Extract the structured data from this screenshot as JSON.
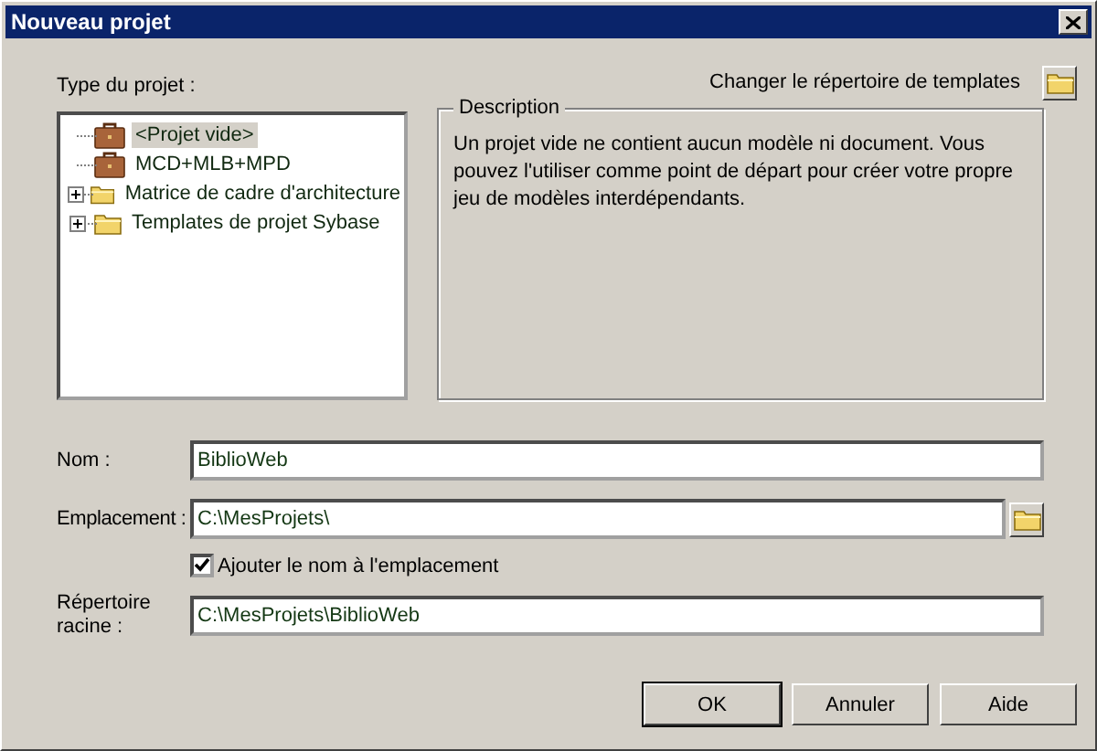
{
  "window": {
    "title": "Nouveau projet"
  },
  "project_type": {
    "label": "Type du projet :",
    "items": [
      {
        "label": "<Projet vide>",
        "kind": "briefcase",
        "selected": true
      },
      {
        "label": "MCD+MLB+MPD",
        "kind": "briefcase",
        "selected": false
      },
      {
        "label": "Matrice de cadre d'architecture",
        "kind": "folder",
        "expanded": false,
        "selected": false
      },
      {
        "label": "Templates de projet Sybase",
        "kind": "folder",
        "expanded": false,
        "selected": false
      }
    ]
  },
  "change_templates": {
    "label": "Changer le répertoire de templates"
  },
  "description": {
    "title": "Description",
    "text": "Un projet vide ne contient aucun modèle ni document. Vous pouvez l'utiliser comme point de départ pour créer votre propre jeu de modèles interdépendants."
  },
  "name": {
    "label": "Nom :",
    "value": "BiblioWeb"
  },
  "location": {
    "label": "Emplacement :",
    "value": "C:\\MesProjets\\"
  },
  "append_name": {
    "label": "Ajouter le nom à l'emplacement",
    "checked": true
  },
  "root": {
    "label": "Répertoire racine :",
    "value": "C:\\MesProjets\\BiblioWeb"
  },
  "buttons": [
    {
      "label": "OK",
      "default": true
    },
    {
      "label": "Annuler",
      "default": false
    },
    {
      "label": "Aide",
      "default": false
    }
  ]
}
